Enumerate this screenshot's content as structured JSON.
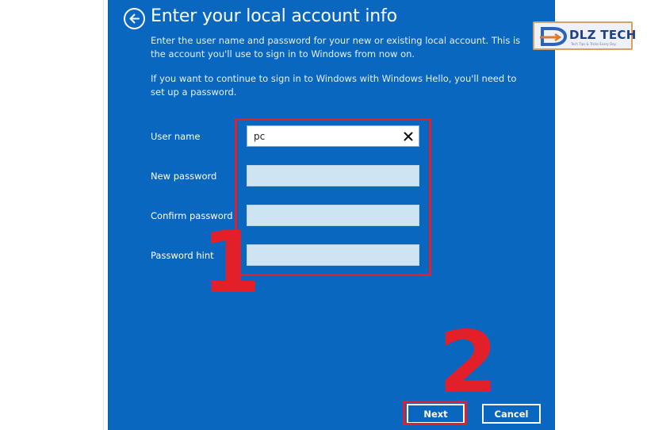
{
  "dialog": {
    "title": "Enter your local account info",
    "paragraph1": "Enter the user name and password for your new or existing local account. This is the account you'll use to sign in to Windows from now on.",
    "paragraph2": "If you want to continue to sign in to Windows with Windows Hello, you'll need to set up a password."
  },
  "form": {
    "username_label": "User name",
    "username_value": "pc",
    "new_password_label": "New password",
    "confirm_password_label": "Confirm password",
    "password_hint_label": "Password hint"
  },
  "buttons": {
    "next": "Next",
    "cancel": "Cancel"
  },
  "annotations": {
    "step1": "1",
    "step2": "2",
    "highlight_color": "#e3202a"
  },
  "watermark": {
    "brand": "DLZ TECH",
    "tagline": "Tech Tips & Tricks Every Day"
  },
  "colors": {
    "panel_bg": "#0a67bf",
    "field_bg": "#cfe4f3",
    "text": "#ffffff"
  }
}
